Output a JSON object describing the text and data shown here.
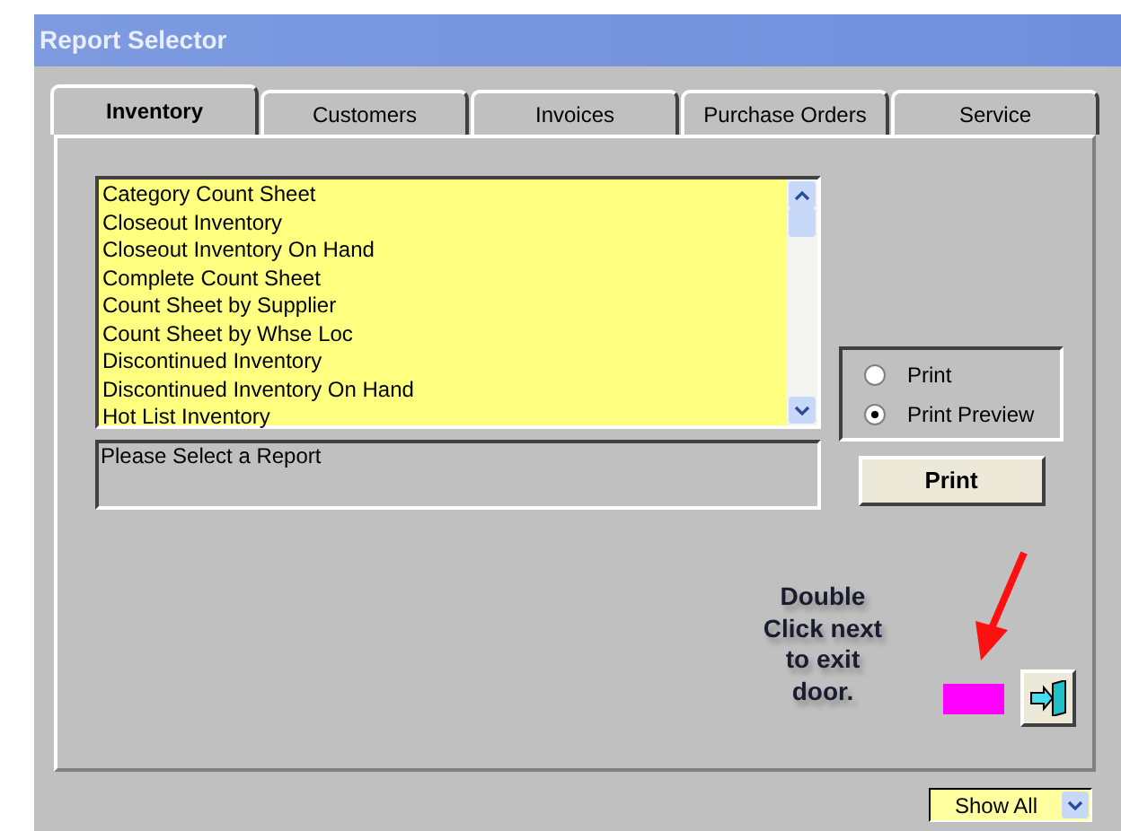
{
  "window": {
    "title": "Report Selector"
  },
  "tabs": [
    {
      "label": "Inventory",
      "selected": true
    },
    {
      "label": "Customers",
      "selected": false
    },
    {
      "label": "Invoices",
      "selected": false
    },
    {
      "label": "Purchase Orders",
      "selected": false
    },
    {
      "label": "Service",
      "selected": false
    }
  ],
  "reports": [
    "Category Count Sheet",
    "Closeout Inventory",
    "Closeout Inventory On Hand",
    "Complete Count Sheet",
    "Count Sheet by Supplier",
    "Count Sheet by Whse Loc",
    "Discontinued Inventory",
    "Discontinued Inventory On Hand",
    "Hot List Inventory"
  ],
  "status": "Please Select a Report",
  "output_options": [
    {
      "label": "Print",
      "selected": false
    },
    {
      "label": "Print Preview",
      "selected": true
    }
  ],
  "print_button": "Print",
  "annotation": "Double Click next to exit door.",
  "filter": {
    "value": "Show All"
  }
}
